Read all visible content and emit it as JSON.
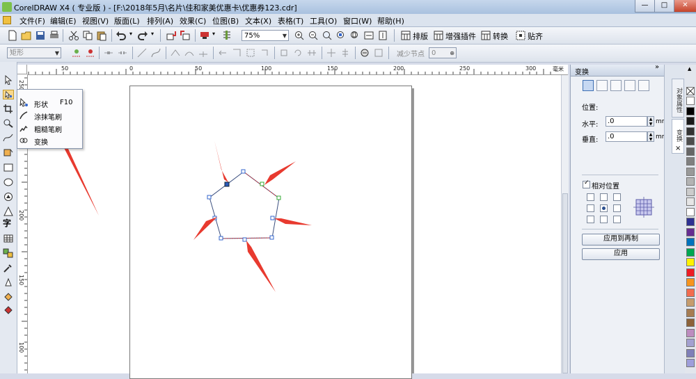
{
  "window": {
    "title": "CorelDRAW X4 ( 专业版 ) - [F:\\2018年5月\\名片\\佳和家美优惠卡\\优惠券123.cdr]",
    "minimize": "—",
    "maximize": "□",
    "close": "✕"
  },
  "menu": [
    "文件(F)",
    "编辑(E)",
    "视图(V)",
    "版面(L)",
    "排列(A)",
    "效果(C)",
    "位图(B)",
    "文本(X)",
    "表格(T)",
    "工具(O)",
    "窗口(W)",
    "帮助(H)"
  ],
  "std_toolbar": {
    "zoom": "75%",
    "labels": [
      "排版",
      "增强插件",
      "转换",
      "贴齐"
    ]
  },
  "prop_toolbar": {
    "object_type": "矩形",
    "reduce_nodes_label": "减少节点",
    "reduce_nodes_value": "0"
  },
  "ruler_h": [
    "50",
    "0",
    "50",
    "100",
    "150",
    "200",
    "250",
    "300",
    "毫米"
  ],
  "ruler_v": [
    "250",
    "200",
    "150",
    "100"
  ],
  "flyout": {
    "items": [
      {
        "label": "形状",
        "shortcut": "F10"
      },
      {
        "label": "涂抹笔刷",
        "shortcut": ""
      },
      {
        "label": "粗糙笔刷",
        "shortcut": ""
      },
      {
        "label": "变换",
        "shortcut": ""
      }
    ]
  },
  "panel": {
    "title": "变换",
    "position_label": "位置:",
    "h_label": "水平:",
    "h_value": ".0",
    "v_label": "垂直:",
    "v_value": ".0",
    "unit": "mm",
    "relative_label": "相对位置",
    "apply_dup": "应用到再制",
    "apply": "应用"
  },
  "side_tabs": [
    "对象属性",
    "变换"
  ],
  "palette": [
    "#ffffff",
    "#000000",
    "#1a1a1a",
    "#333333",
    "#4d4d4d",
    "#666666",
    "#808080",
    "#999999",
    "#b3b3b3",
    "#cccccc",
    "#e6e6e6",
    "#ffffff",
    "#2e3192",
    "#662d91",
    "#0072bc",
    "#00a651",
    "#fff200",
    "#ed1c24",
    "#f7941d",
    "#f26c4f",
    "#c69c6d",
    "#a67c52",
    "#8c6239",
    "#bd8cbf",
    "#a3a0d0",
    "#7f7fb8",
    "#9e9edb"
  ]
}
